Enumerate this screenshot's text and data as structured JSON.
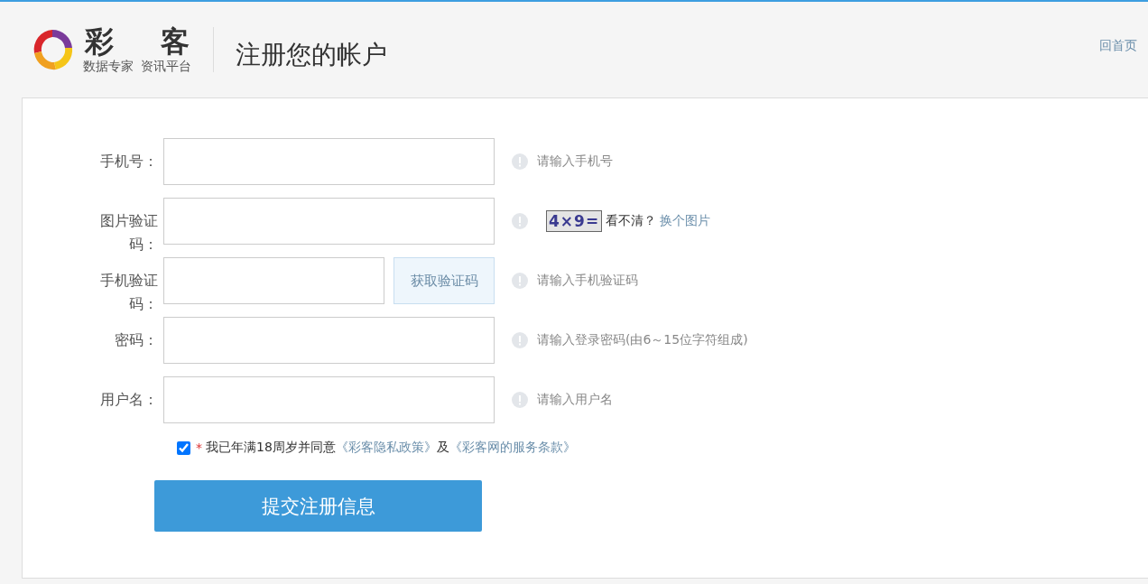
{
  "header": {
    "logo_char_1": "彩",
    "logo_char_2": "客",
    "logo_tagline_1": "数据专家",
    "logo_tagline_2": "资讯平台",
    "title": "注册您的帐户",
    "home_link": "回首页"
  },
  "form": {
    "fields": [
      {
        "kind": "input",
        "label": "手机号：",
        "hint": "请输入手机号"
      },
      {
        "kind": "captcha",
        "label": "图片验证码：",
        "captcha_text": "4×9=",
        "captcha_prompt": "看不清？",
        "captcha_link": "换个图片"
      },
      {
        "kind": "sms",
        "label": "手机验证码：",
        "button": "获取验证码",
        "hint": "请输入手机验证码"
      },
      {
        "kind": "input",
        "label": "密码：",
        "hint": "请输入登录密码(由6～15位字符组成)"
      },
      {
        "kind": "input",
        "label": "用户名：",
        "hint": "请输入用户名"
      }
    ],
    "agreement": {
      "checked": true,
      "required_mark": "*",
      "text": "我已年满18周岁并同意",
      "link_1": "《彩客隐私政策》",
      "joiner": "及",
      "link_2": "《彩客网的服务条款》"
    },
    "submit": "提交注册信息"
  }
}
